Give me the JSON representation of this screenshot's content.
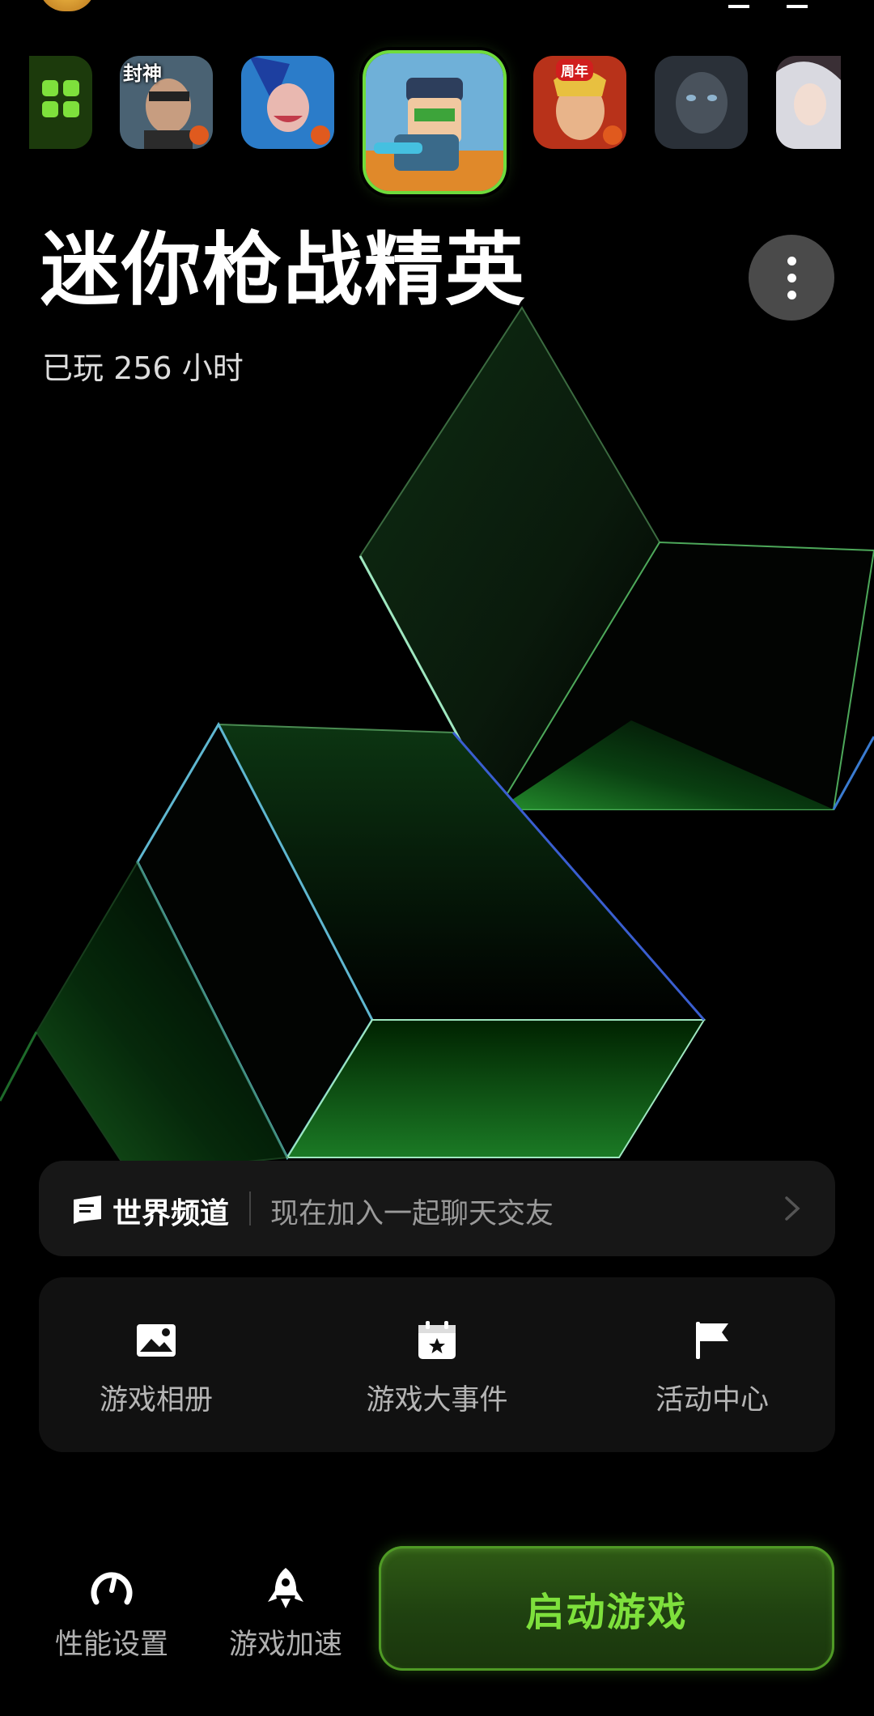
{
  "game_strip": {
    "items": [
      {
        "name": "all-games",
        "label": ""
      },
      {
        "name": "cf",
        "label": "封神"
      },
      {
        "name": "jinx",
        "label": ""
      },
      {
        "name": "mini-gun",
        "label": "",
        "selected": true
      },
      {
        "name": "hok",
        "label": "周年"
      },
      {
        "name": "dark",
        "label": ""
      },
      {
        "name": "anime",
        "label": ""
      }
    ]
  },
  "game": {
    "title": "迷你枪战精英",
    "play_time": "已玩 256 小时"
  },
  "world_channel": {
    "name": "世界频道",
    "message": "现在加入一起聊天交友"
  },
  "tools": [
    {
      "label": "游戏相册",
      "icon": "photo-album-icon"
    },
    {
      "label": "游戏大事件",
      "icon": "calendar-star-icon"
    },
    {
      "label": "活动中心",
      "icon": "flag-icon"
    }
  ],
  "bottom_bar": {
    "performance_label": "性能设置",
    "boost_label": "游戏加速",
    "launch_label": "启动游戏"
  },
  "colors": {
    "accent_green": "#7ee03c",
    "selected_border": "#6fdc3c",
    "background": "#000000"
  }
}
